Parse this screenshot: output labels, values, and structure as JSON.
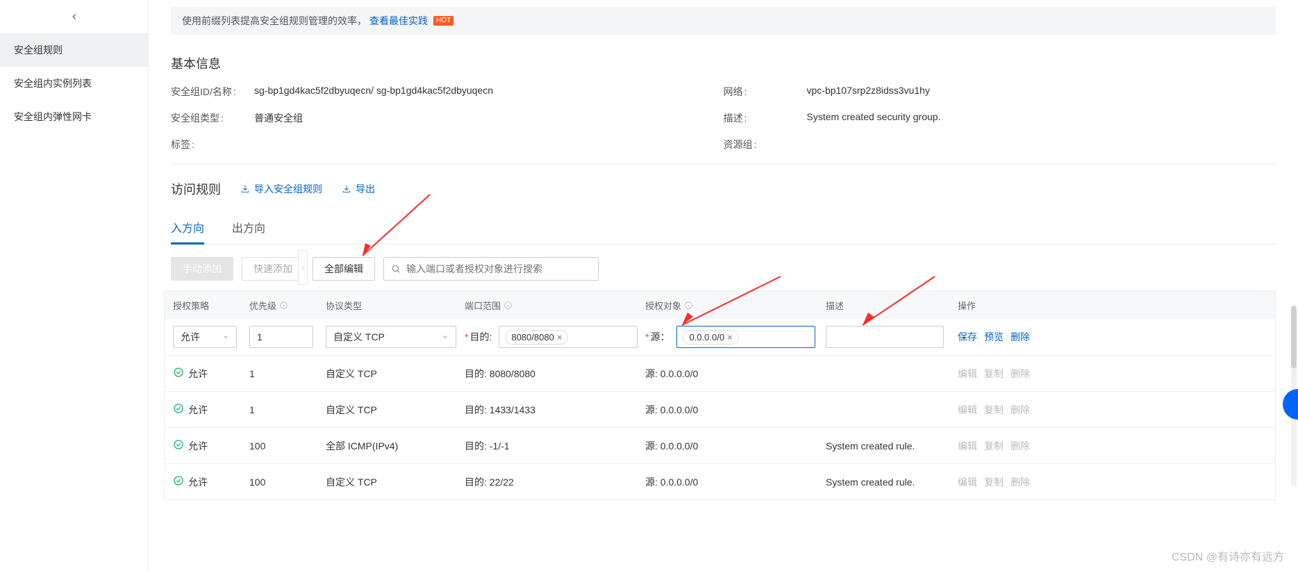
{
  "sidebar": {
    "items": [
      {
        "label": "安全组规则",
        "active": true
      },
      {
        "label": "安全组内实例列表",
        "active": false
      },
      {
        "label": "安全组内弹性网卡",
        "active": false
      }
    ]
  },
  "banner": {
    "prefix": "使用前缀列表提高安全组规则管理的效率，",
    "link": "查看最佳实践",
    "badge": "HOT"
  },
  "basic": {
    "title": "基本信息",
    "id_label": "安全组ID/名称",
    "id_value": "sg-bp1gd4kac5f2dbyuqecn/ sg-bp1gd4kac5f2dbyuqecn",
    "type_label": "安全组类型",
    "type_value": "普通安全组",
    "tag_label": "标签",
    "tag_value": "",
    "net_label": "网络",
    "net_value": "vpc-bp107srp2z8idss3vu1hy",
    "desc_label": "描述",
    "desc_value": "System created security group.",
    "res_label": "资源组",
    "res_value": ""
  },
  "access": {
    "title": "访问规则",
    "import_label": "导入安全组规则",
    "export_label": "导出"
  },
  "tabs": {
    "inbound": "入方向",
    "outbound": "出方向"
  },
  "toolbar": {
    "manual_add": "手动添加",
    "quick_add": "快速添加",
    "edit_all": "全部编辑",
    "search_placeholder": "输入端口或者授权对象进行搜索"
  },
  "table": {
    "headers": {
      "policy": "授权策略",
      "priority": "优先级",
      "protocol": "协议类型",
      "port": "端口范围",
      "target": "授权对象",
      "desc": "描述",
      "action": "操作"
    },
    "edit_row": {
      "policy_value": "允许",
      "priority_value": "1",
      "protocol_value": "自定义 TCP",
      "port_label": "目的:",
      "port_chip": "8080/8080",
      "target_label": "源：",
      "target_chip": "0.0.0.0/0",
      "actions": {
        "save": "保存",
        "preview": "预览",
        "delete": "删除"
      }
    },
    "rows": [
      {
        "policy": "允许",
        "priority": "1",
        "protocol": "自定义 TCP",
        "port": "目的: 8080/8080",
        "target": "源: 0.0.0.0/0",
        "desc": ""
      },
      {
        "policy": "允许",
        "priority": "1",
        "protocol": "自定义 TCP",
        "port": "目的: 1433/1433",
        "target": "源: 0.0.0.0/0",
        "desc": ""
      },
      {
        "policy": "允许",
        "priority": "100",
        "protocol": "全部 ICMP(IPv4)",
        "port": "目的: -1/-1",
        "target": "源: 0.0.0.0/0",
        "desc": "System created rule."
      },
      {
        "policy": "允许",
        "priority": "100",
        "protocol": "自定义 TCP",
        "port": "目的: 22/22",
        "target": "源: 0.0.0.0/0",
        "desc": "System created rule."
      }
    ],
    "row_actions": {
      "edit": "编辑",
      "copy": "复制",
      "delete": "删除"
    }
  },
  "watermark": "CSDN @有诗亦有远方"
}
